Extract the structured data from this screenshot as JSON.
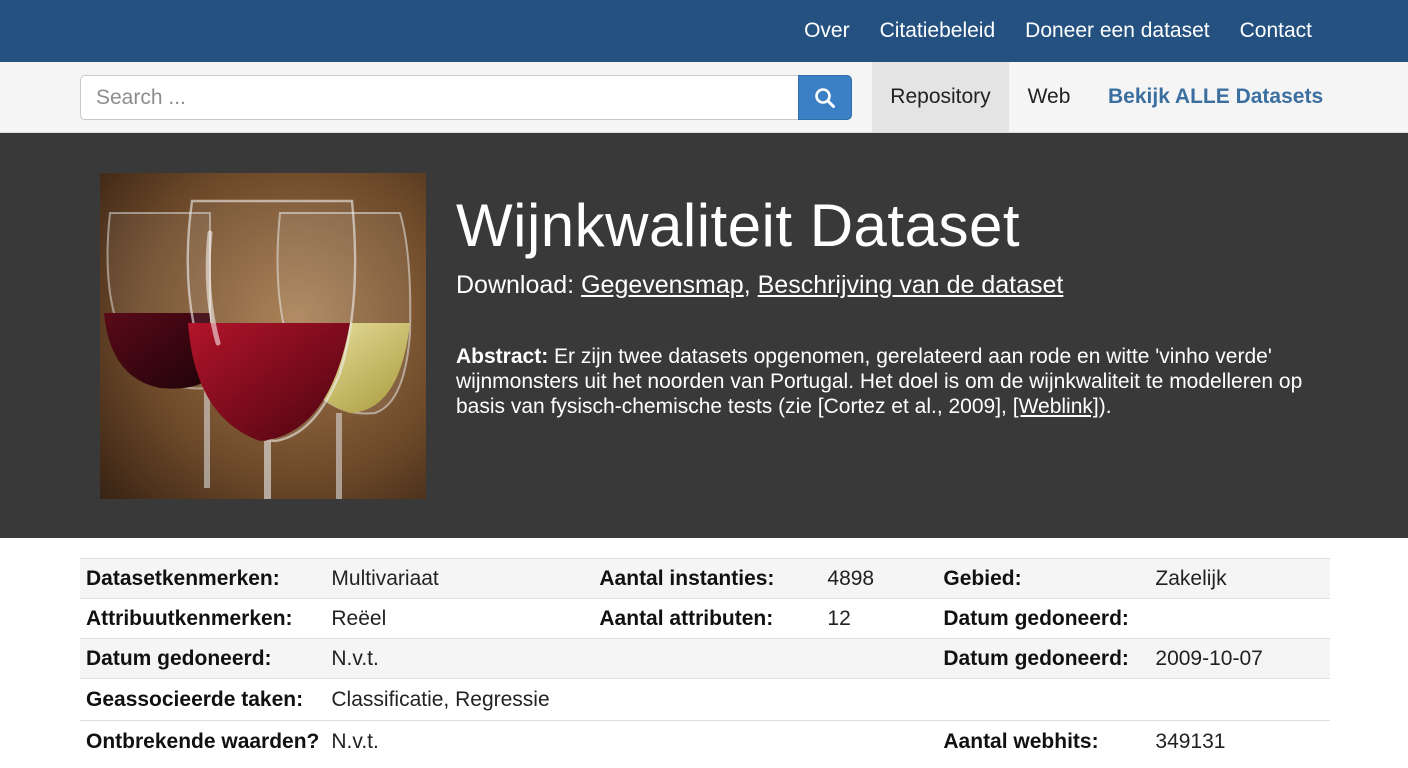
{
  "topnav": {
    "links": [
      "Over",
      "Citatiebeleid",
      "Doneer een dataset",
      "Contact"
    ]
  },
  "search": {
    "placeholder": "Search ...",
    "button_icon": "search-icon"
  },
  "tabs": {
    "repository": "Repository",
    "web": "Web",
    "all": "Bekijk ALLE Datasets"
  },
  "hero": {
    "image_icon": "wine-glasses-image",
    "title": "Wijnkwaliteit Dataset",
    "download_label": "Download:",
    "download_link1": "Gegevensmap",
    "download_sep": ",",
    "download_link2": "Beschrijving van de dataset",
    "abstract_label": "Abstract:",
    "abstract_text": "Er zijn twee datasets opgenomen, gerelateerd aan rode en witte 'vinho verde' wijnmonsters uit het noorden van Portugal. Het doel is om de wijnkwaliteit te modelleren op basis van fysisch-chemische tests (zie [Cortez et al., 2009], ",
    "abstract_link": "[Weblink]",
    "abstract_end": ")."
  },
  "table": {
    "rows": [
      [
        "Datasetkenmerken:",
        "Multivariaat",
        "Aantal instanties:",
        "4898",
        "Gebied:",
        "Zakelijk"
      ],
      [
        "Attribuutkenmerken:",
        "Reëel",
        "Aantal attributen:",
        "12",
        "Datum gedoneerd:",
        ""
      ],
      [
        "Datum gedoneerd:",
        "N.v.t.",
        "",
        "",
        "Datum gedoneerd:",
        "2009-10-07"
      ],
      [
        "Geassocieerde taken:",
        "Classificatie, Regressie",
        "",
        "",
        "",
        ""
      ],
      [
        "Ontbrekende waarden?",
        "N.v.t.",
        "",
        "",
        "Aantal webhits:",
        "349131"
      ]
    ]
  },
  "colors": {
    "topnav": "#245180",
    "search_button": "#3b7fc4",
    "hero_bg": "#393939",
    "link_accent": "#3b6f9f"
  }
}
